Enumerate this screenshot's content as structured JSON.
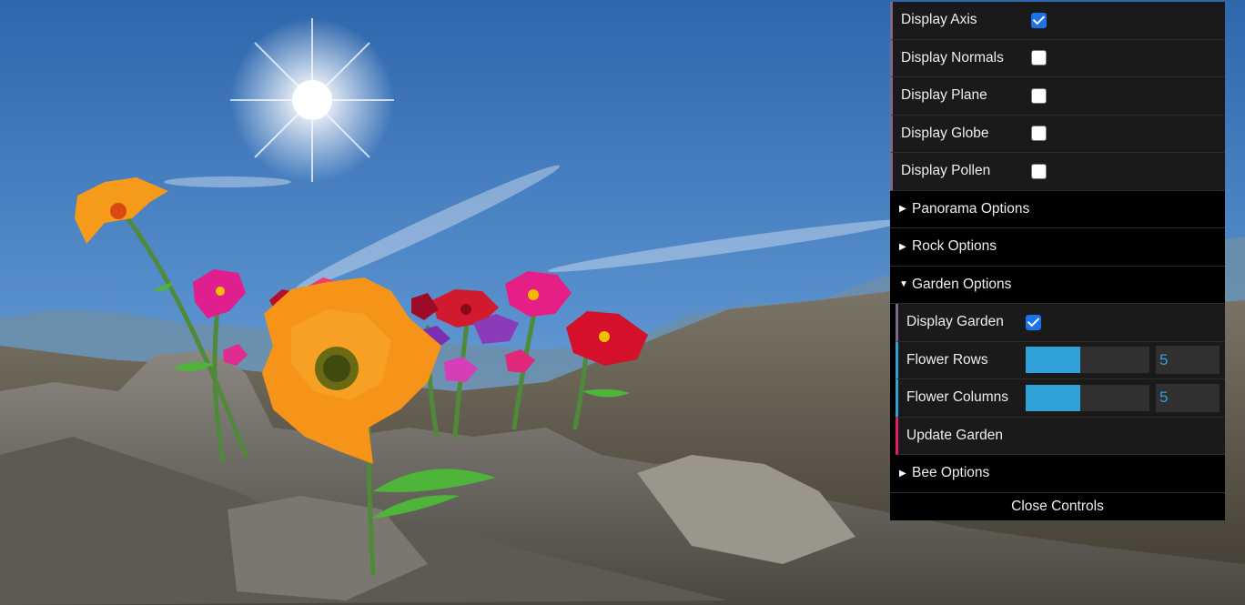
{
  "gui": {
    "display": [
      {
        "label": "Display Axis",
        "checked": true
      },
      {
        "label": "Display Normals",
        "checked": false
      },
      {
        "label": "Display Plane",
        "checked": false
      },
      {
        "label": "Display Globe",
        "checked": false
      },
      {
        "label": "Display Pollen",
        "checked": false
      }
    ],
    "folders": {
      "panorama": {
        "label": "Panorama Options",
        "open": false
      },
      "rock": {
        "label": "Rock Options",
        "open": false
      },
      "garden": {
        "label": "Garden Options",
        "open": true,
        "display_garden": {
          "label": "Display Garden",
          "checked": true
        },
        "flower_rows": {
          "label": "Flower Rows",
          "value": "5",
          "fraction": 0.44
        },
        "flower_columns": {
          "label": "Flower Columns",
          "value": "5",
          "fraction": 0.44
        },
        "update": {
          "label": "Update Garden"
        }
      },
      "bee": {
        "label": "Bee Options",
        "open": false
      }
    },
    "close_label": "Close Controls"
  },
  "colors": {
    "panel": "#1a1a1a",
    "boolean_accent": "#806787",
    "number_accent": "#2fa1d6",
    "function_accent": "#e61d5f",
    "checkbox_on": "#1a73e8"
  }
}
